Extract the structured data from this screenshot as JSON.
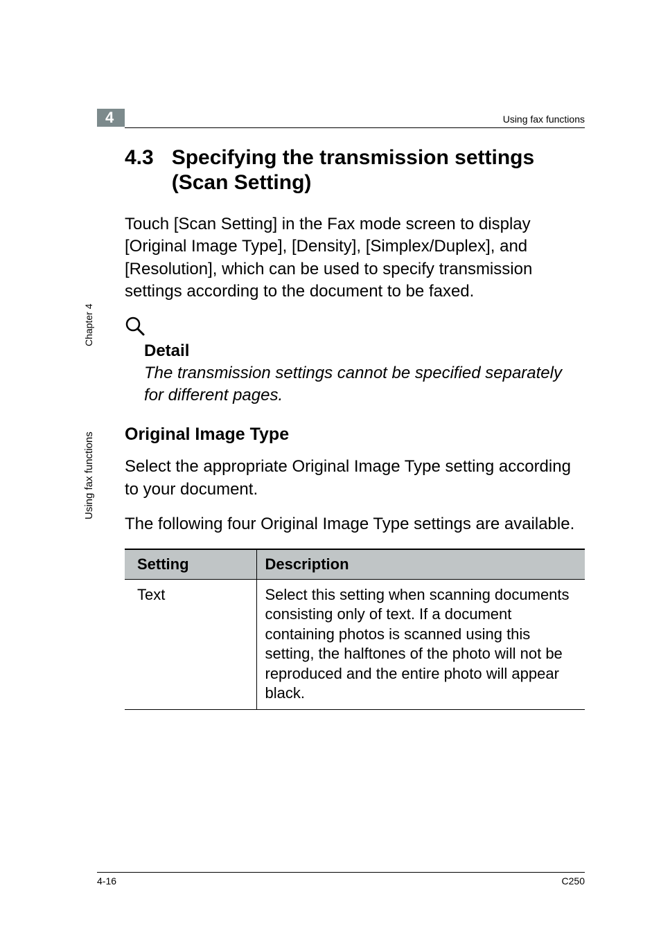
{
  "running_header": "Using fax functions",
  "chapter_badge": "4",
  "sidebar": {
    "chapter_label": "Chapter 4",
    "title": "Using fax functions"
  },
  "section": {
    "number": "4.3",
    "title": "Specifying the transmission settings (Scan Setting)"
  },
  "intro_paragraph": "Touch [Scan Setting] in the Fax mode screen to display [Original Image Type], [Density], [Simplex/Duplex], and [Resolution], which can be used to specify transmission settings according to the document to be faxed.",
  "detail": {
    "label": "Detail",
    "text": "The transmission settings cannot be specified separately for different pages."
  },
  "subsection_heading": "Original Image Type",
  "subsection_para1": "Select the appropriate Original Image Type setting according to your document.",
  "subsection_para2": "The following four Original Image Type settings are available.",
  "table": {
    "headers": {
      "col1": "Setting",
      "col2": "Description"
    },
    "rows": [
      {
        "setting": "Text",
        "description": "Select this setting when scanning documents consisting only of text. If a document containing photos is scanned using this setting, the halftones of the photo will not be reproduced and the entire photo will appear black."
      }
    ]
  },
  "footer": {
    "page_num": "4-16",
    "product": "C250"
  }
}
